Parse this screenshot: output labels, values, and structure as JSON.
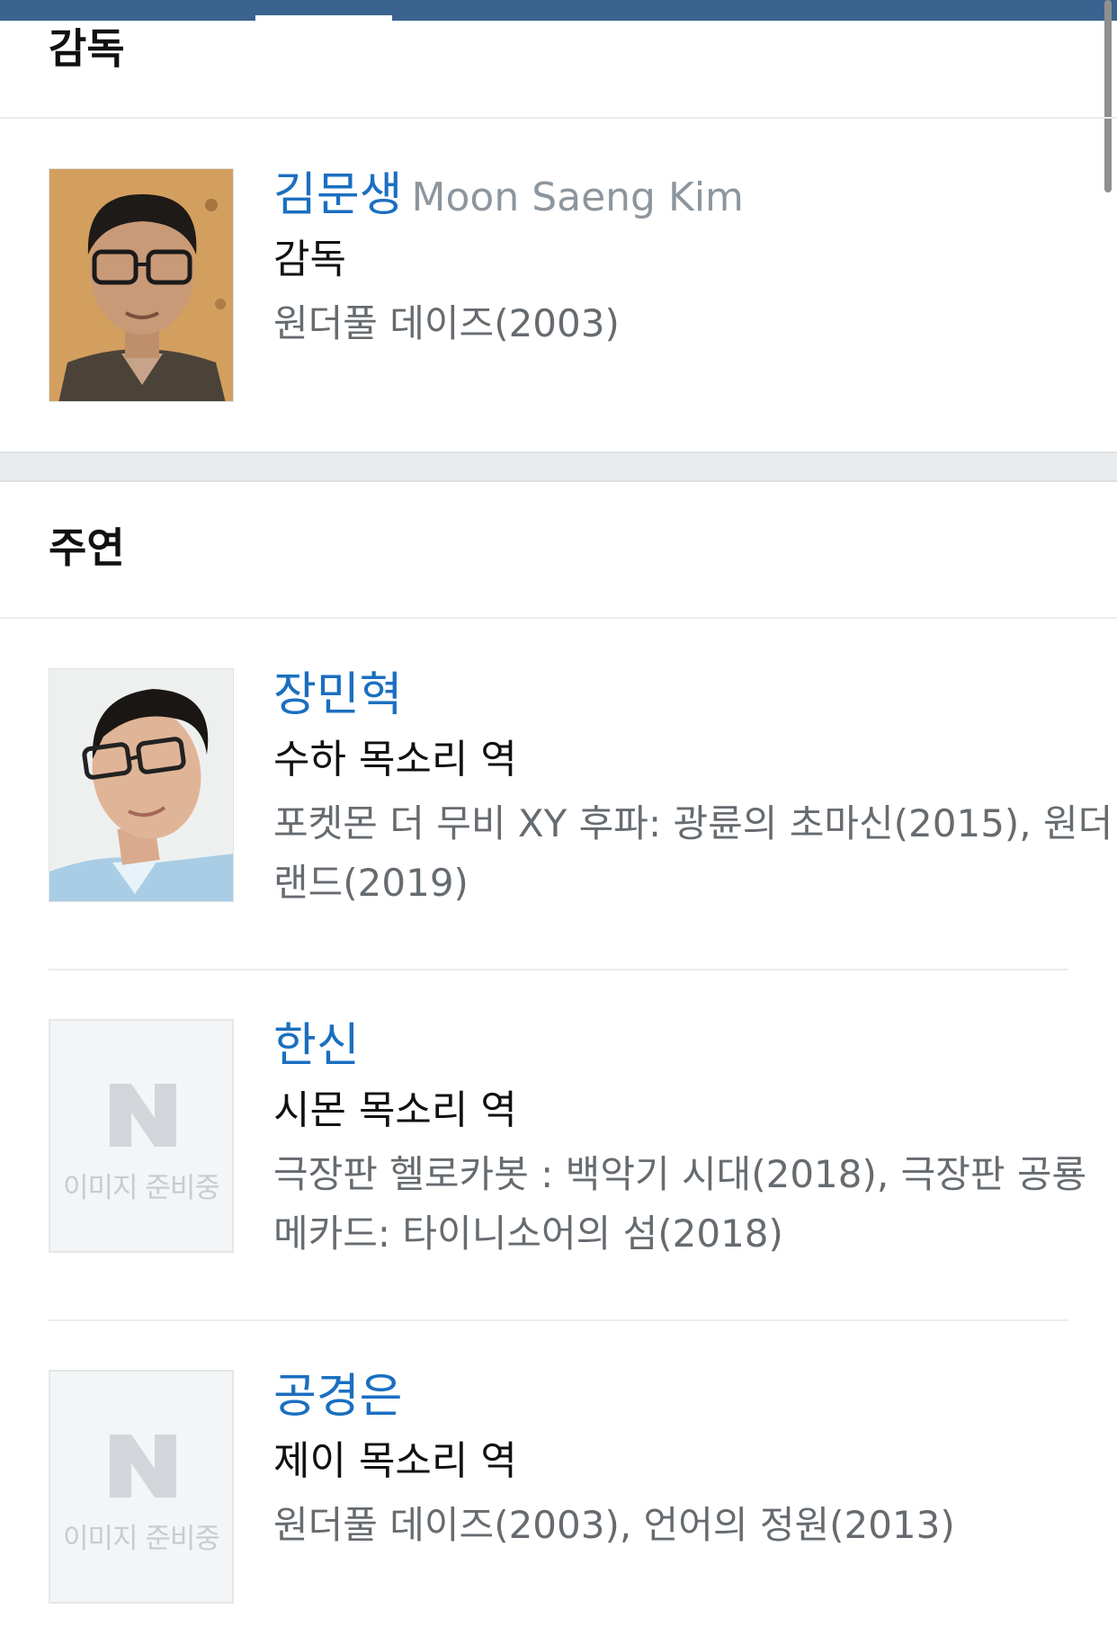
{
  "sections": {
    "director_title": "감독",
    "cast_title": "주연"
  },
  "director": {
    "name": "김문생",
    "english_name": "Moon Saeng Kim",
    "role": "감독",
    "works": "원더풀 데이즈(2003)"
  },
  "cast": [
    {
      "name": "장민혁",
      "role": "수하 목소리 역",
      "works": "포켓몬 더 무비 XY 후파: 광륜의 초마신(2015), 원더랜드(2019)"
    },
    {
      "name": "한신",
      "role": "시몬 목소리 역",
      "works": "극장판 헬로카봇 : 백악기 시대(2018), 극장판 공룡메카드: 타이니소어의 섬(2018)",
      "placeholder_text": "이미지 준비중"
    },
    {
      "name": "공경은",
      "role": "제이 목소리 역",
      "works": "원더풀 데이즈(2003), 언어의 정원(2013)",
      "placeholder_text": "이미지 준비중"
    }
  ],
  "colors": {
    "link": "#1a6fc0",
    "top_bar": "#3b6390",
    "muted": "#666b70",
    "english_name": "#8d969e"
  },
  "icons": {
    "placeholder_logo": "naver-n-logo"
  }
}
